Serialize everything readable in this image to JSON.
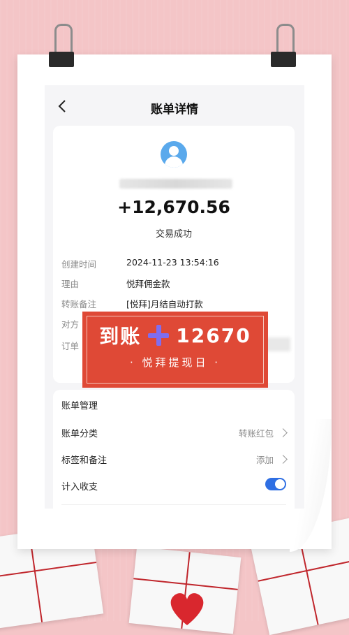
{
  "nav": {
    "title": "账单详情"
  },
  "transaction": {
    "amount": "+12,670.56",
    "status": "交易成功"
  },
  "details": [
    {
      "label": "创建时间",
      "value": "2024-11-23 13:54:16"
    },
    {
      "label": "理由",
      "value": "悦拜佣金款"
    },
    {
      "label": "转账备注",
      "value": "[悦拜]月结自动打款"
    },
    {
      "label": "对方",
      "value": ""
    },
    {
      "label": "订单",
      "value": ""
    }
  ],
  "management": {
    "title": "账单管理",
    "category_label": "账单分类",
    "category_value": "转账红包",
    "tags_label": "标签和备注",
    "tags_value": "添加",
    "income_label": "计入收支"
  },
  "banner": {
    "left_text": "到账",
    "amount_text": "12670",
    "subtitle": "· 悦拜提现日 ·"
  },
  "colors": {
    "background": "#f4c5c7",
    "banner": "#df4936",
    "plus": "#7f6df0",
    "toggle": "#2f6fe3",
    "avatar": "#5aa9ec"
  },
  "icons": [
    "back-arrow-icon",
    "avatar-icon",
    "chevron-right-icon",
    "toggle-switch"
  ]
}
